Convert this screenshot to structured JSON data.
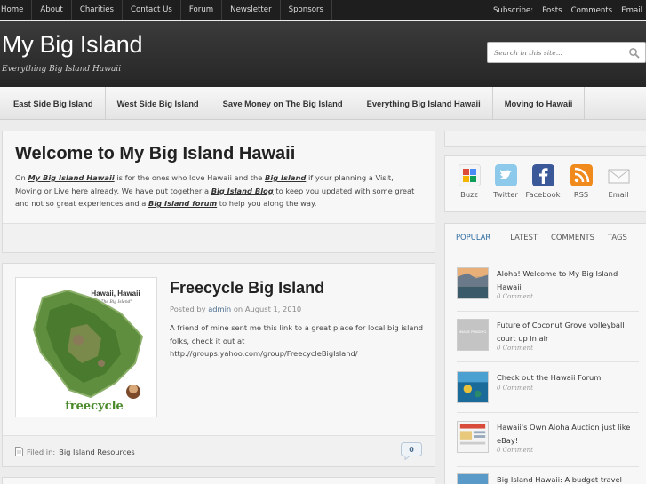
{
  "topnav": {
    "items": [
      "Home",
      "About",
      "Charities",
      "Contact Us",
      "Forum",
      "Newsletter",
      "Sponsors"
    ],
    "subscribe_label": "Subscribe:",
    "subscribe_links": [
      "Posts",
      "Comments",
      "Email"
    ]
  },
  "header": {
    "title": "My Big Island",
    "tagline": "Everything Big Island Hawaii",
    "search_placeholder": "Search in this site..."
  },
  "catnav": {
    "items": [
      "East Side Big Island",
      "West Side Big Island",
      "Save Money on The Big Island",
      "Everything Big Island Hawaii",
      "Moving to Hawaii"
    ]
  },
  "welcome": {
    "title": "Welcome to My Big Island Hawaii",
    "t1": "On ",
    "l1": "My Big Island Hawaii",
    "t2": " is for the ones who love Hawaii and the ",
    "l2": "Big Island",
    "t3": " if your planning a Visit, Moving or Live here already.  We have put together a ",
    "l3": "Big Island Blog",
    "t4": " to keep you updated with some great and not so great experiences and a ",
    "l4": "Big Island forum",
    "t5": " to help you along the way."
  },
  "post": {
    "title": "Freecycle Big Island",
    "posted_by_label": "Posted by",
    "author": "admin",
    "on_label": "on",
    "date": "August 1, 2010",
    "body": "A friend of mine sent me this link to a great place for local big island folks, check it out at http://groups.yahoo.com/group/FreecycleBigIsland/",
    "thumb_title": "Hawaii, Hawaii",
    "thumb_subtitle": "\"The Big Island\"",
    "thumb_logo": "freecycle",
    "filed_label": "Filed in:",
    "category": "Big Island Resources",
    "comment_count": "0"
  },
  "social": {
    "items": [
      {
        "label": "Buzz",
        "icon": "buzz-icon",
        "color": "#e6b022"
      },
      {
        "label": "Twitter",
        "icon": "twitter-icon",
        "color": "#7ec4e6"
      },
      {
        "label": "Facebook",
        "icon": "facebook-icon",
        "color": "#3b5998"
      },
      {
        "label": "RSS",
        "icon": "rss-icon",
        "color": "#f08a1c"
      },
      {
        "label": "Email",
        "icon": "email-icon",
        "color": "#e0e0e0"
      }
    ]
  },
  "tabs": {
    "items": [
      "POPULAR",
      "LATEST",
      "COMMENTS",
      "TAGS"
    ],
    "active": "POPULAR"
  },
  "popular": [
    {
      "title": "Aloha! Welcome to My Big Island Hawaii",
      "comments": "0 Comment"
    },
    {
      "title": "Future of Coconut Grove volleyball court up in air",
      "comments": "0 Comment",
      "thumb_text": "IMAGE PENDING"
    },
    {
      "title": "Check out the Hawaii Forum",
      "comments": "0 Comment"
    },
    {
      "title": "Hawaii's Own Aloha Auction just like eBay!",
      "comments": "0 Comment"
    },
    {
      "title": "Big Island Hawaii: A budget travel",
      "comments": ""
    }
  ],
  "colors": {
    "topbar": "#1e1e1e",
    "header": "#2f2f2f",
    "link_blue": "#2a6aa0",
    "page_bg": "#ececec"
  }
}
